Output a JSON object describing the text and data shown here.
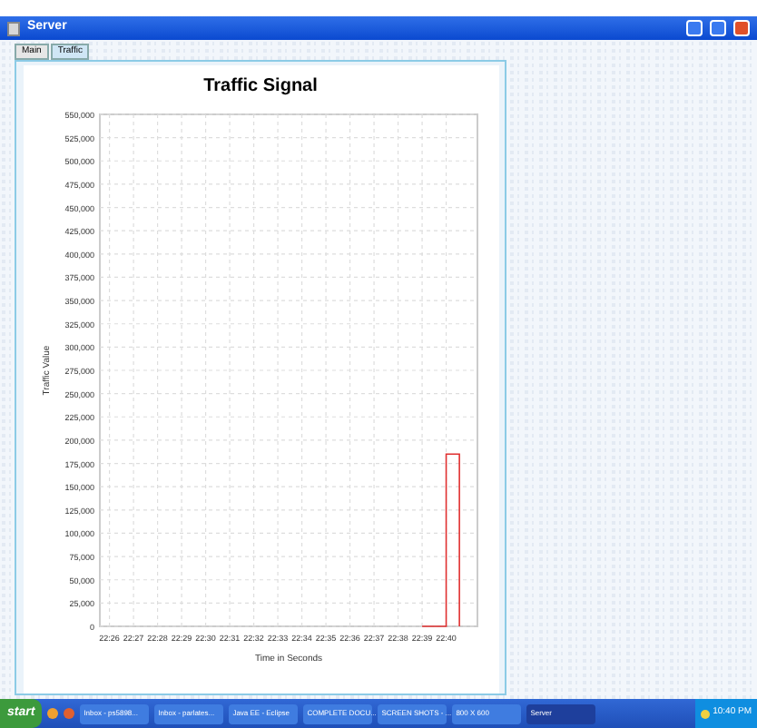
{
  "window": {
    "title": "Server"
  },
  "tabs": [
    {
      "label": "Main",
      "selected": false
    },
    {
      "label": "Traffic",
      "selected": true
    }
  ],
  "chart": {
    "chart_data": {
      "type": "line",
      "title": "Traffic Signal",
      "xlabel": "Time in Seconds",
      "ylabel": "Traffic Value",
      "grid": true,
      "x": [
        1359,
        1360,
        1360,
        1360.55,
        1360.55
      ],
      "series": [
        {
          "color": "#e03030",
          "values": [
            0,
            0,
            185000,
            185000,
            0
          ]
        }
      ],
      "xlim": [
        1345.6,
        1361.3
      ],
      "ylim": [
        0,
        550000
      ],
      "xticks": [
        {
          "value": 1346,
          "label": "22:26"
        },
        {
          "value": 1347,
          "label": "22:27"
        },
        {
          "value": 1348,
          "label": "22:28"
        },
        {
          "value": 1349,
          "label": "22:29"
        },
        {
          "value": 1350,
          "label": "22:30"
        },
        {
          "value": 1351,
          "label": "22:31"
        },
        {
          "value": 1352,
          "label": "22:32"
        },
        {
          "value": 1353,
          "label": "22:33"
        },
        {
          "value": 1354,
          "label": "22:34"
        },
        {
          "value": 1355,
          "label": "22:35"
        },
        {
          "value": 1356,
          "label": "22:36"
        },
        {
          "value": 1357,
          "label": "22:37"
        },
        {
          "value": 1358,
          "label": "22:38"
        },
        {
          "value": 1359,
          "label": "22:39"
        },
        {
          "value": 1360,
          "label": "22:40"
        }
      ],
      "yticks": [
        {
          "value": 0,
          "label": "0"
        },
        {
          "value": 25000,
          "label": "25,000"
        },
        {
          "value": 50000,
          "label": "50,000"
        },
        {
          "value": 75000,
          "label": "75,000"
        },
        {
          "value": 100000,
          "label": "100,000"
        },
        {
          "value": 125000,
          "label": "125,000"
        },
        {
          "value": 150000,
          "label": "150,000"
        },
        {
          "value": 175000,
          "label": "175,000"
        },
        {
          "value": 200000,
          "label": "200,000"
        },
        {
          "value": 225000,
          "label": "225,000"
        },
        {
          "value": 250000,
          "label": "250,000"
        },
        {
          "value": 275000,
          "label": "275,000"
        },
        {
          "value": 300000,
          "label": "300,000"
        },
        {
          "value": 325000,
          "label": "325,000"
        },
        {
          "value": 350000,
          "label": "350,000"
        },
        {
          "value": 375000,
          "label": "375,000"
        },
        {
          "value": 400000,
          "label": "400,000"
        },
        {
          "value": 425000,
          "label": "425,000"
        },
        {
          "value": 450000,
          "label": "450,000"
        },
        {
          "value": 475000,
          "label": "475,000"
        },
        {
          "value": 500000,
          "label": "500,000"
        },
        {
          "value": 525000,
          "label": "525,000"
        },
        {
          "value": 550000,
          "label": "550,000"
        }
      ]
    }
  },
  "taskbar": {
    "start": "start",
    "items": [
      {
        "label": "Inbox - ps5898...",
        "selected": false
      },
      {
        "label": "Inbox - parlates...",
        "selected": false
      },
      {
        "label": "Java EE - Eclipse",
        "selected": false
      },
      {
        "label": "COMPLETE DOCU...",
        "selected": false
      },
      {
        "label": "SCREEN SHOTS - ...",
        "selected": false
      },
      {
        "label": "800 X 600",
        "selected": false
      },
      {
        "label": "Server",
        "selected": true
      }
    ],
    "clock": "10:40 PM"
  }
}
